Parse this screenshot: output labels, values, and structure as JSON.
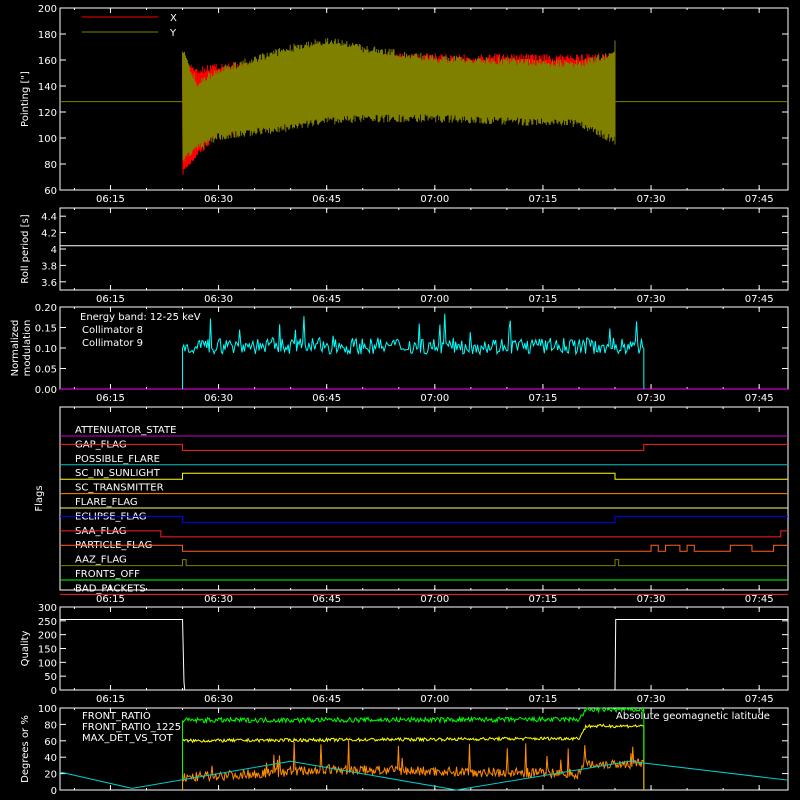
{
  "time_axis": {
    "tick_labels": [
      "06:15",
      "06:30",
      "06:45",
      "07:00",
      "07:15",
      "07:30",
      "07:45"
    ],
    "range": [
      "06:08",
      "07:49"
    ]
  },
  "chart_data": [
    {
      "type": "line",
      "panel": "pointing",
      "ylabel": "Pointing [\"]",
      "ylim": [
        60,
        200
      ],
      "yticks": [
        60,
        80,
        100,
        120,
        140,
        160,
        180,
        200
      ],
      "legend": [
        "X",
        "Y"
      ],
      "series": [
        {
          "name": "X",
          "color": "#ff0000",
          "start": "06:25",
          "end": "07:25",
          "envelope_time": [
            "06:25",
            "06:27",
            "06:30",
            "06:40",
            "06:50",
            "07:00",
            "07:10",
            "07:20",
            "07:25"
          ],
          "upper": [
            165,
            155,
            158,
            163,
            165,
            165,
            165,
            165,
            166
          ],
          "lower": [
            70,
            85,
            100,
            112,
            120,
            123,
            124,
            124,
            125
          ]
        },
        {
          "name": "Y",
          "color": "#808000",
          "start": "06:25",
          "end": "07:25",
          "baseline": 128,
          "envelope_time": [
            "06:25",
            "06:27",
            "06:30",
            "06:40",
            "06:45",
            "06:50",
            "07:00",
            "07:10",
            "07:20",
            "07:25"
          ],
          "upper": [
            170,
            145,
            155,
            172,
            178,
            172,
            164,
            162,
            160,
            168
          ],
          "lower": [
            80,
            90,
            98,
            105,
            110,
            112,
            112,
            110,
            108,
            95
          ]
        }
      ]
    },
    {
      "type": "line",
      "panel": "roll_period",
      "ylabel": "Roll period [s]",
      "ylim": [
        3.5,
        4.5
      ],
      "yticks": [
        3.6,
        3.8,
        4.0,
        4.2,
        4.4
      ],
      "series": [
        {
          "name": "Roll period",
          "color": "#ffffff",
          "value": 4.04
        }
      ]
    },
    {
      "type": "line",
      "panel": "modulation",
      "ylabel": "Normalized modulation",
      "ylim": [
        0,
        0.2
      ],
      "yticks": [
        "0.00",
        "0.05",
        "0.10",
        "0.15",
        "0.20"
      ],
      "annotation": "Energy band: 12-25 keV",
      "legend": [
        "Collimator 8",
        "Collimator 9"
      ],
      "series": [
        {
          "name": "Collimator 8",
          "color": "#00ffff",
          "start": "06:25",
          "end": "07:29",
          "mean": 0.105,
          "noise": 0.02
        },
        {
          "name": "Collimator 9",
          "color": "#ff00ff",
          "value": 0.0
        }
      ]
    },
    {
      "type": "line",
      "panel": "flags",
      "ylabel": "Flags",
      "flags": [
        {
          "name": "ATTENUATOR_STATE",
          "color": "#cc00cc",
          "segments": [
            [
              "06:08",
              0,
              1
            ]
          ]
        },
        {
          "name": "GAP_FLAG",
          "color": "#ff2020",
          "segments": [
            [
              "06:08",
              1
            ],
            [
              "06:25",
              0
            ],
            [
              "07:29",
              1
            ]
          ]
        },
        {
          "name": "POSSIBLE_FLARE",
          "color": "#00c8c8",
          "segments": [
            [
              "06:08",
              0
            ]
          ]
        },
        {
          "name": "SC_IN_SUNLIGHT",
          "color": "#ffff00",
          "segments": [
            [
              "06:08",
              0
            ],
            [
              "06:25",
              1
            ],
            [
              "07:25",
              0
            ]
          ]
        },
        {
          "name": "SC_TRANSMITTER",
          "color": "#ff8c00",
          "segments": [
            [
              "06:08",
              0
            ]
          ]
        },
        {
          "name": "FLARE_FLAG",
          "color": "#ffff60",
          "segments": [
            [
              "06:08",
              0
            ]
          ]
        },
        {
          "name": "ECLIPSE_FLAG",
          "color": "#0000ff",
          "segments": [
            [
              "06:08",
              1
            ],
            [
              "06:25",
              0
            ],
            [
              "07:25",
              1
            ]
          ]
        },
        {
          "name": "SAA_FLAG",
          "color": "#ff2020",
          "segments": [
            [
              "06:08",
              1
            ],
            [
              "06:22",
              0
            ],
            [
              "07:48",
              1
            ]
          ]
        },
        {
          "name": "PARTICLE_FLAG",
          "color": "#ff6020",
          "segments": [
            [
              "06:08",
              1
            ],
            [
              "06:25",
              0
            ],
            [
              "07:30",
              1
            ],
            [
              "07:31",
              0
            ],
            [
              "07:32",
              1
            ],
            [
              "07:34",
              0
            ],
            [
              "07:35",
              1
            ],
            [
              "07:36",
              0
            ],
            [
              "07:41",
              1
            ],
            [
              "07:44",
              0
            ],
            [
              "07:47",
              1
            ]
          ]
        },
        {
          "name": "AAZ_FLAG",
          "color": "#808000",
          "segments": [
            [
              "06:08",
              0
            ],
            [
              "06:25",
              1
            ],
            [
              "06:25.5",
              0
            ],
            [
              "07:25",
              1
            ],
            [
              "07:25.5",
              0
            ]
          ]
        },
        {
          "name": "FRONTS_OFF",
          "color": "#00ff00",
          "segments": [
            [
              "06:08",
              0
            ]
          ]
        },
        {
          "name": "BAD_PACKETS",
          "color": "#ff2020",
          "segments": [
            [
              "06:08",
              0
            ]
          ]
        }
      ]
    },
    {
      "type": "line",
      "panel": "quality",
      "ylabel": "Quality",
      "ylim": [
        0,
        300
      ],
      "yticks": [
        0,
        50,
        100,
        150,
        200,
        250,
        300
      ],
      "series": [
        {
          "name": "Quality",
          "color": "#ffffff",
          "points": [
            [
              "06:08",
              255
            ],
            [
              "06:25",
              255
            ],
            [
              "06:25.2",
              30
            ],
            [
              "06:25.3",
              0
            ],
            [
              "07:25",
              0
            ],
            [
              "07:25.1",
              255
            ],
            [
              "07:49",
              255
            ]
          ]
        }
      ]
    },
    {
      "type": "line",
      "panel": "ratios",
      "ylabel": "Degrees or %",
      "ylim": [
        0,
        100
      ],
      "yticks": [
        0,
        20,
        40,
        60,
        80,
        100
      ],
      "legend": [
        "FRONT_RATIO",
        "FRONT_RATIO_1225",
        "MAX_DET_VS_TOT"
      ],
      "legend_right": "Absolute geomagnetic latitude",
      "series": [
        {
          "name": "FRONT_RATIO",
          "color": "#ffff00",
          "start": "06:25",
          "end": "07:29",
          "levels": [
            [
              "06:25",
              60
            ],
            [
              "07:20",
              63
            ],
            [
              "07:21",
              78
            ]
          ],
          "noise": 2
        },
        {
          "name": "FRONT_RATIO_1225",
          "color": "#00ff00",
          "start": "06:25",
          "end": "07:29",
          "levels": [
            [
              "06:25",
              85
            ],
            [
              "07:20",
              86
            ],
            [
              "07:21",
              98
            ]
          ],
          "noise": 3
        },
        {
          "name": "MAX_DET_VS_TOT",
          "color": "#ff8c00",
          "start": "06:25",
          "end": "07:29",
          "levels": [
            [
              "06:25",
              15
            ],
            [
              "06:45",
              25
            ],
            [
              "07:20",
              20
            ],
            [
              "07:21",
              32
            ]
          ],
          "noise": 6
        },
        {
          "name": "Absolute geomagnetic latitude",
          "color": "#00cccc",
          "points": [
            [
              "06:08",
              22
            ],
            [
              "06:18",
              2
            ],
            [
              "06:40",
              35
            ],
            [
              "07:03",
              0
            ],
            [
              "07:27",
              35
            ],
            [
              "07:49",
              12
            ]
          ]
        }
      ]
    }
  ]
}
